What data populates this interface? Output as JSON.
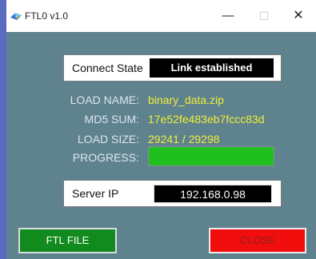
{
  "window": {
    "title": "FTL0 v1.0",
    "minimize_glyph": "—",
    "maximize_glyph": "☐",
    "close_glyph": "✕",
    "icon": "app-icon"
  },
  "connect": {
    "label": "Connect State",
    "value": "Link established"
  },
  "load": {
    "name_label": "LOAD NAME:",
    "name_value": "binary_data.zip",
    "md5_label": "MD5 SUM:",
    "md5_value": "17e52fe483eb7fccc83d",
    "size_label": "LOAD SIZE:",
    "size_value": "29241 / 29298"
  },
  "progress": {
    "label": "PROGRESS:",
    "value": 1.0
  },
  "server": {
    "label": "Server IP",
    "value": "192.168.0.98"
  },
  "buttons": {
    "ftl_file": "FTL FILE",
    "close": "CLOSE"
  },
  "colors": {
    "background": "#5f828f",
    "value_text": "#f1ef36",
    "progress_fill": "#1fbf1f",
    "ftl_button": "#118b1e",
    "close_button": "#f30e0e"
  }
}
